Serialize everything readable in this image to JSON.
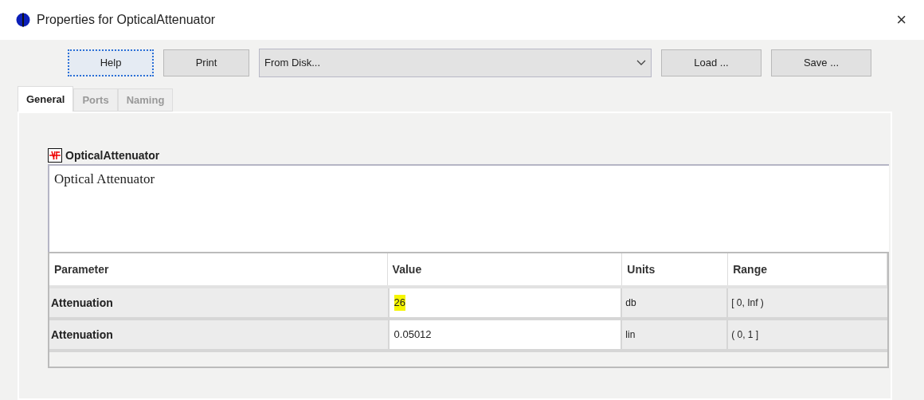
{
  "window": {
    "title": "Properties for OpticalAttenuator",
    "close": "×"
  },
  "toolbar": {
    "buttons": [
      {
        "label": "Help",
        "focused": true
      },
      {
        "label": "Print",
        "focused": false
      }
    ],
    "source": {
      "value": "From Disk..."
    },
    "actions": [
      "Load ...",
      "Save ..."
    ]
  },
  "tabs": [
    {
      "label": "General",
      "selected": true
    },
    {
      "label": "Ports",
      "selected": false
    },
    {
      "label": "Naming",
      "selected": false
    }
  ],
  "component": {
    "name": "OpticalAttenuator",
    "description": "Optical Attenuator"
  },
  "table": {
    "columns": [
      "Parameter",
      "Value",
      "Units",
      "Range"
    ],
    "rows": [
      {
        "parameter": "Attenuation",
        "value": "26",
        "highlighted": true,
        "units": "db",
        "range": "[ 0, Inf )"
      },
      {
        "parameter": "Attenuation",
        "value": "0.05012",
        "highlighted": false,
        "units": "lin",
        "range": "( 0, 1 ]"
      }
    ]
  }
}
